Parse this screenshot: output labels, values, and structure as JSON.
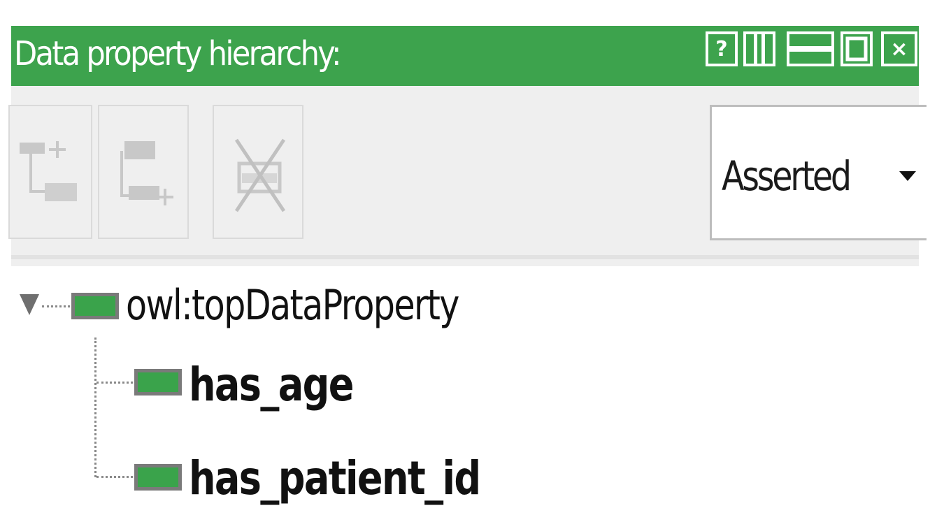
{
  "panel": {
    "title": "Data property hierarchy:",
    "title_bar_color": "#3da34d",
    "window_buttons": [
      {
        "icon": "help-icon",
        "glyph": "?"
      },
      {
        "icon": "pin-icon",
        "glyph": ""
      },
      {
        "icon": "minimize-icon",
        "glyph": ""
      },
      {
        "icon": "maximize-icon",
        "glyph": ""
      },
      {
        "icon": "close-icon",
        "glyph": "×"
      }
    ]
  },
  "toolbar": {
    "buttons": [
      {
        "icon": "add-sub-property-icon"
      },
      {
        "icon": "add-sibling-property-icon"
      },
      {
        "icon": "delete-property-icon"
      }
    ],
    "view_mode": {
      "selected": "Asserted"
    }
  },
  "tree": {
    "root": {
      "label": "owl:topDataProperty",
      "expanded": true,
      "icon": "data-property-icon",
      "icon_color": "#3aa34b"
    },
    "children": [
      {
        "label": "has_age",
        "icon": "data-property-icon"
      },
      {
        "label": "has_patient_id",
        "icon": "data-property-icon"
      }
    ]
  }
}
